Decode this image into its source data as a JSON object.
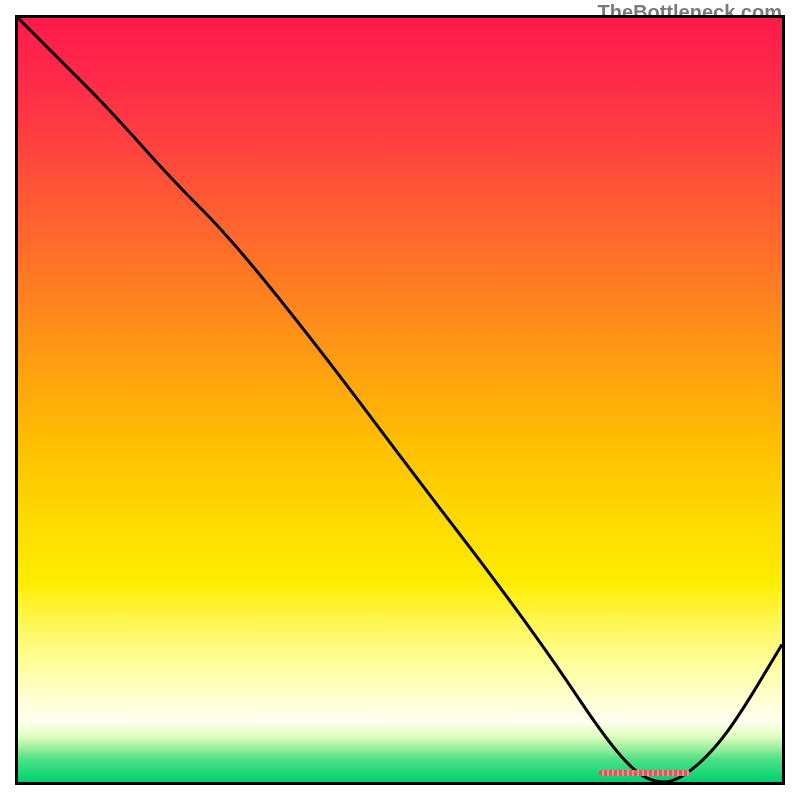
{
  "attribution": "TheBottleneck.com",
  "chart_data": {
    "type": "line",
    "title": "",
    "xlabel": "",
    "ylabel": "",
    "xlim": [
      0,
      100
    ],
    "ylim": [
      0,
      100
    ],
    "x": [
      0,
      5,
      12,
      20,
      28,
      40,
      52,
      62,
      70,
      76,
      80,
      83,
      86,
      90,
      94,
      100
    ],
    "values": [
      100,
      95,
      88,
      79,
      71,
      56,
      40,
      27,
      16,
      7,
      2,
      0,
      0,
      3,
      8,
      18
    ],
    "marker_band": {
      "x_start": 76,
      "x_end": 88,
      "y": 0.5
    },
    "gradient_stops": [
      {
        "pos": 0,
        "color": "#ff1a4a"
      },
      {
        "pos": 50,
        "color": "#ffc000"
      },
      {
        "pos": 85,
        "color": "#ffffd0"
      },
      {
        "pos": 100,
        "color": "#00d070"
      }
    ]
  }
}
